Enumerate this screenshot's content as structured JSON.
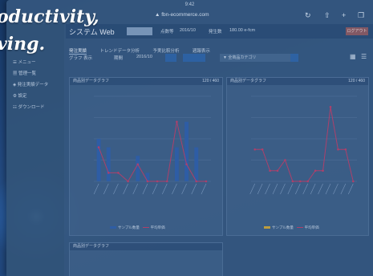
{
  "banner": {
    "line1": "oductivity,",
    "line2": "ving."
  },
  "statusbar": {
    "time": "9:42"
  },
  "browser": {
    "url": "▲ fbn-ecommerce.com"
  },
  "app": {
    "title": "システム Web",
    "meta1": "点数等",
    "meta2": "2016/10",
    "meta3": "発生数",
    "meta4": "180.00 e-fcm",
    "action": "ログアウト"
  },
  "sidebar": {
    "items": [
      "☰ メニュー",
      "▦ 管理一覧",
      "◈ 発注実績データ",
      "⚙ 設定",
      "☷ ダウンロード"
    ]
  },
  "tabs": [
    "発注実績",
    "トレンドデータ分析",
    "予実比較分析",
    "週報表示"
  ],
  "controls": {
    "view_label": "グラフ 表示",
    "period_label": "期間",
    "date_value": "2016/10",
    "select_label": "▼ 全商品カテゴリ"
  },
  "panels": {
    "p1": {
      "title": "商品別データグラフ",
      "count": "120 / 460"
    },
    "p2": {
      "title": "商品別データグラフ",
      "count": "120 / 460"
    },
    "p3": {
      "title": "商品別データグラフ"
    }
  },
  "legend": {
    "bar_label": "サンプル数量",
    "line_label": "平均単価",
    "bar2_label": "サンプル数量",
    "line2_label": "平均単価"
  },
  "chart_data": [
    {
      "type": "bar",
      "series": [
        {
          "name": "サンプル数量",
          "values": [
            5,
            4,
            0,
            0,
            3,
            1,
            0,
            0,
            4,
            7,
            4,
            0
          ]
        },
        {
          "name": "平均単価",
          "values": [
            4,
            1,
            1,
            0,
            2,
            0,
            0,
            0,
            7,
            2,
            0,
            0
          ]
        }
      ],
      "ylim": [
        0,
        10
      ],
      "colors": {
        "bar": "#2f5fa8",
        "line": "#b8406a"
      }
    },
    {
      "type": "line",
      "series": [
        {
          "name": "平均単価",
          "values": [
            3,
            3,
            1,
            1,
            2,
            0,
            0,
            0,
            1,
            1,
            7,
            3,
            3,
            0
          ]
        }
      ],
      "ylim": [
        0,
        8
      ],
      "colors": {
        "line": "#b8406a"
      }
    }
  ]
}
